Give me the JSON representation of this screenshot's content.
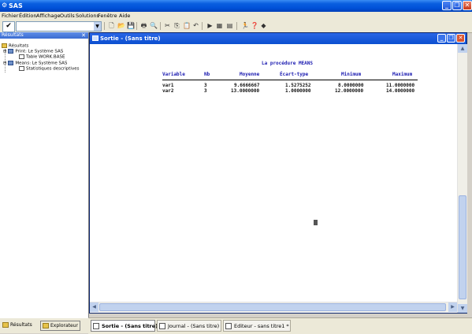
{
  "app": {
    "title": "SAS"
  },
  "menu": [
    "Fichier",
    "Édition",
    "Affichage",
    "Outils",
    "Solutions",
    "Fenêtre",
    "Aide"
  ],
  "toolbar": {
    "command_value": "",
    "icons": [
      "submit-check-icon",
      "new-icon",
      "open-icon",
      "save-icon",
      "print-icon",
      "print-preview-icon",
      "cut-icon",
      "copy-icon",
      "paste-icon",
      "undo-icon",
      "submit-icon",
      "explorer-icon",
      "results-icon",
      "running-man-icon",
      "help-icon",
      "sas-logo-icon"
    ]
  },
  "results_panel": {
    "title": "Résultats",
    "tree": [
      {
        "label": "Résultats",
        "level": 0,
        "icon": "results-tree-icon"
      },
      {
        "label": "Print:  Le Système SAS",
        "level": 1,
        "icon": "book-icon"
      },
      {
        "label": "Table WORK.BASE",
        "level": 2,
        "icon": "document-icon"
      },
      {
        "label": "Means:  Le Système SAS",
        "level": 1,
        "icon": "book-icon"
      },
      {
        "label": "Statistiques descriptives",
        "level": 2,
        "icon": "document-icon"
      }
    ],
    "tabs": [
      {
        "label": "Résultats",
        "icon": "results-tab-icon",
        "active": false
      },
      {
        "label": "Explorateur",
        "icon": "explorer-tab-icon",
        "active": true
      }
    ]
  },
  "output_window": {
    "title": "Sortie - (Sans titre)",
    "procedure_title": "La procédure MEANS",
    "columns": [
      "Variable",
      "Nb",
      "Moyenne",
      "Écart-type",
      "Minimum",
      "Maximum"
    ],
    "rows": [
      [
        "var1",
        "3",
        "9.6666667",
        "1.5275252",
        "8.0000000",
        "11.0000000"
      ],
      [
        "var2",
        "3",
        "13.0000000",
        "1.0000000",
        "12.0000000",
        "14.0000000"
      ]
    ]
  },
  "taskbar": [
    {
      "label": "Sortie - (Sans titre)",
      "icon": "output-window-icon",
      "active": true
    },
    {
      "label": "Journal - (Sans titre)",
      "icon": "log-window-icon",
      "active": false
    },
    {
      "label": "Editeur - sans titre1 *",
      "icon": "editor-window-icon",
      "active": false
    }
  ]
}
